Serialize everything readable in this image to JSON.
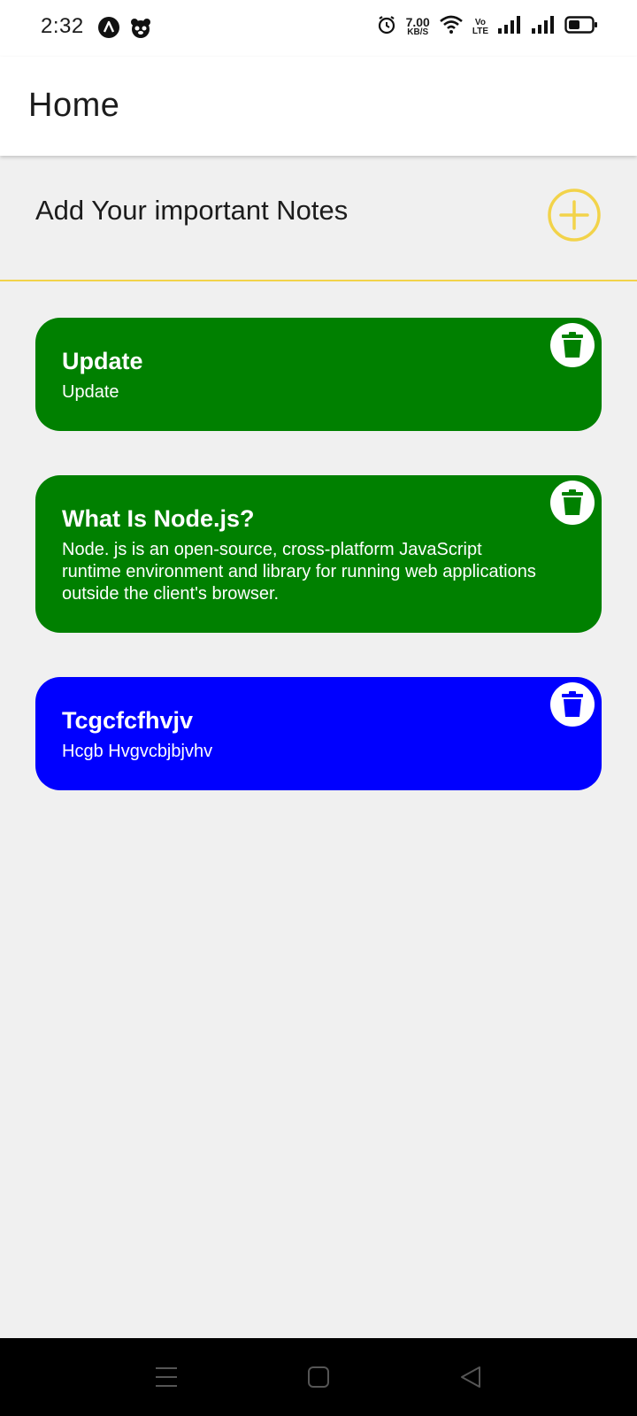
{
  "status_bar": {
    "time": "2:32",
    "net_speed_value": "7.00",
    "net_speed_unit": "KB/S",
    "volte_top": "Vo",
    "volte_bottom": "LTE",
    "icons": [
      "app-a-icon",
      "panda-icon",
      "alarm-icon",
      "wifi-icon",
      "volte-icon",
      "signal-icon",
      "signal-icon",
      "battery-icon"
    ]
  },
  "app_bar": {
    "title": "Home"
  },
  "add_section": {
    "prompt": "Add Your important Notes",
    "add_icon": "plus-circle-icon"
  },
  "notes": [
    {
      "title": "Update",
      "body": "Update",
      "color": "#008000"
    },
    {
      "title": "What Is Node.js?",
      "body": "Node. js is an open-source, cross-platform JavaScript runtime environment and library for running web applications outside the client's browser.",
      "color": "#008000"
    },
    {
      "title": "Tcgcfcfhvjv",
      "body": "Hcgb Hvgvcbjbjvhv",
      "color": "#0000ff"
    }
  ],
  "nav_bar": {
    "icons": [
      "menu-icon",
      "home-icon",
      "back-icon"
    ]
  },
  "colors": {
    "accent": "#f2d34a",
    "background": "#f0f0f0",
    "note_green": "#008000",
    "note_blue": "#0000ff"
  }
}
